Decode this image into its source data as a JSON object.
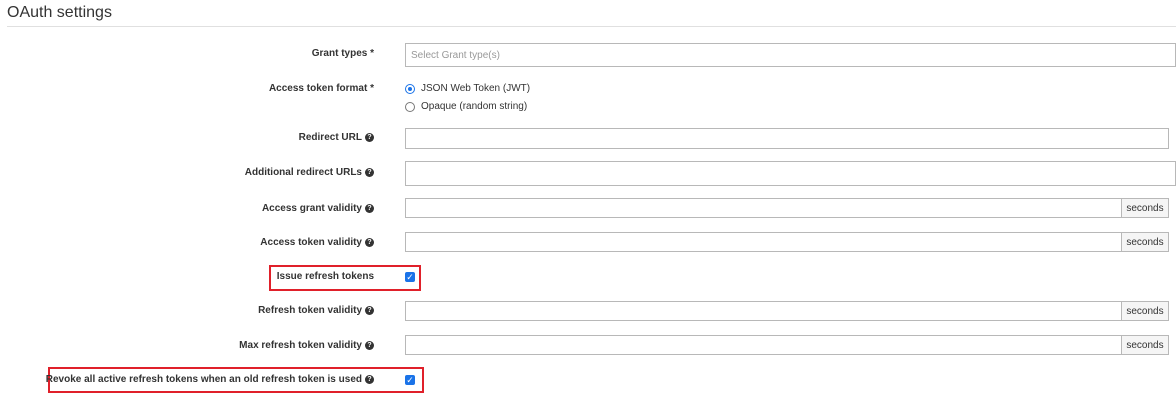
{
  "section": {
    "title": "OAuth settings"
  },
  "fields": {
    "grant_types": {
      "label": "Grant types *",
      "placeholder": "Select Grant type(s)"
    },
    "access_token_format": {
      "label": "Access token format *",
      "options": [
        {
          "label": "JSON Web Token (JWT)",
          "selected": true
        },
        {
          "label": "Opaque (random string)",
          "selected": false
        }
      ]
    },
    "redirect_url": {
      "label": "Redirect URL",
      "value": ""
    },
    "additional_redirect_urls": {
      "label": "Additional redirect URLs",
      "value": ""
    },
    "access_grant_validity": {
      "label": "Access grant validity",
      "value": "",
      "unit": "seconds"
    },
    "access_token_validity": {
      "label": "Access token validity",
      "value": "",
      "unit": "seconds"
    },
    "issue_refresh_tokens": {
      "label": "Issue refresh tokens",
      "checked": true
    },
    "refresh_token_validity": {
      "label": "Refresh token validity",
      "value": "",
      "unit": "seconds"
    },
    "max_refresh_token_validity": {
      "label": "Max refresh token validity",
      "value": "",
      "unit": "seconds"
    },
    "revoke_refresh_tokens": {
      "label": "Revoke all active refresh tokens when an old refresh token is used",
      "checked": true
    }
  },
  "icons": {
    "help": "question-circle-icon",
    "check": "checkmark-icon"
  },
  "colors": {
    "accent": "#1a73e8",
    "highlight": "#e0202a"
  }
}
